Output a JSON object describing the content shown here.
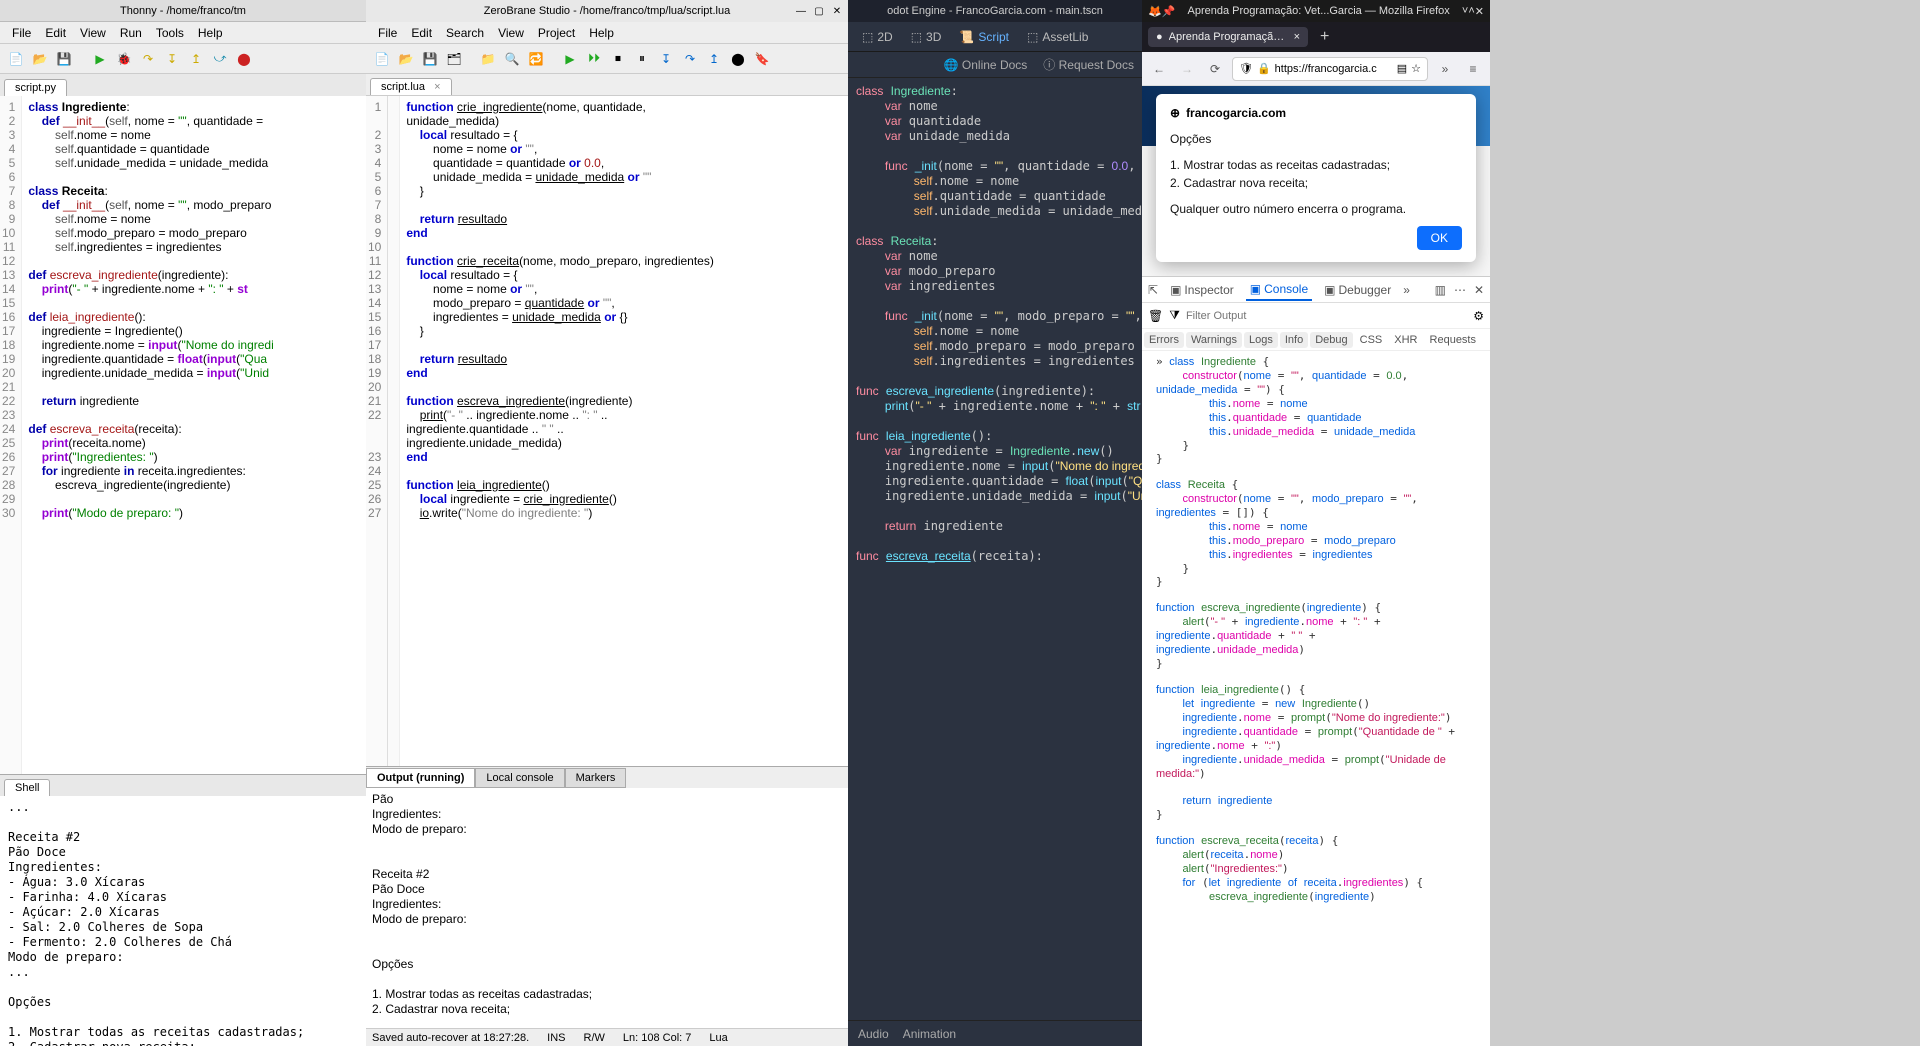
{
  "thonny": {
    "title": "Thonny  -  /home/franco/tm",
    "menu": [
      "File",
      "Edit",
      "View",
      "Run",
      "Tools",
      "Help"
    ],
    "filetab": "script.py",
    "code_lines": [
      {
        "n": 1,
        "h": "<span class='kw'>class</span> <span class='cls'>Ingrediente</span>:"
      },
      {
        "n": 2,
        "h": "    <span class='kw'>def</span> <span class='fn'>__init__</span>(<span class='self'>self</span>, nome = <span class='str'>\"\"</span>, quantidade ="
      },
      {
        "n": 3,
        "h": "        <span class='self'>self</span>.nome = nome"
      },
      {
        "n": 4,
        "h": "        <span class='self'>self</span>.quantidade = quantidade"
      },
      {
        "n": 5,
        "h": "        <span class='self'>self</span>.unidade_medida = unidade_medida"
      },
      {
        "n": 6,
        "h": ""
      },
      {
        "n": 7,
        "h": "<span class='kw'>class</span> <span class='cls'>Receita</span>:"
      },
      {
        "n": 8,
        "h": "    <span class='kw'>def</span> <span class='fn'>__init__</span>(<span class='self'>self</span>, nome = <span class='str'>\"\"</span>, modo_preparo"
      },
      {
        "n": 9,
        "h": "        <span class='self'>self</span>.nome = nome"
      },
      {
        "n": 10,
        "h": "        <span class='self'>self</span>.modo_preparo = modo_preparo"
      },
      {
        "n": 11,
        "h": "        <span class='self'>self</span>.ingredientes = ingredientes"
      },
      {
        "n": 12,
        "h": ""
      },
      {
        "n": 13,
        "h": "<span class='kw'>def</span> <span class='fn'>escreva_ingrediente</span>(ingrediente):"
      },
      {
        "n": 14,
        "h": "    <span class='kw2'>print</span>(<span class='str'>\"- \"</span> + ingrediente.nome + <span class='str'>\": \"</span> + <span class='kw2'>st</span>"
      },
      {
        "n": 15,
        "h": ""
      },
      {
        "n": 16,
        "h": "<span class='kw'>def</span> <span class='fn'>leia_ingrediente</span>():"
      },
      {
        "n": 17,
        "h": "    ingrediente = Ingrediente()"
      },
      {
        "n": 18,
        "h": "    ingrediente.nome = <span class='kw2'>input</span>(<span class='str'>\"Nome do ingredi</span>"
      },
      {
        "n": 19,
        "h": "    ingrediente.quantidade = <span class='kw2'>float</span>(<span class='kw2'>input</span>(<span class='str'>\"Qua</span>"
      },
      {
        "n": 20,
        "h": "    ingrediente.unidade_medida = <span class='kw2'>input</span>(<span class='str'>\"Unid</span>"
      },
      {
        "n": 21,
        "h": ""
      },
      {
        "n": 22,
        "h": "    <span class='kw'>return</span> ingrediente"
      },
      {
        "n": 23,
        "h": ""
      },
      {
        "n": 24,
        "h": "<span class='kw'>def</span> <span class='fn'>escreva_receita</span>(receita):"
      },
      {
        "n": 25,
        "h": "    <span class='kw2'>print</span>(receita.nome)"
      },
      {
        "n": 26,
        "h": "    <span class='kw2'>print</span>(<span class='str'>\"Ingredientes: \"</span>)"
      },
      {
        "n": 27,
        "h": "    <span class='kw'>for</span> ingrediente <span class='kw'>in</span> receita.ingredientes:"
      },
      {
        "n": 28,
        "h": "        escreva_ingrediente(ingrediente)"
      },
      {
        "n": 29,
        "h": ""
      },
      {
        "n": 30,
        "h": "    <span class='kw2'>print</span>(<span class='str'>\"Modo de preparo: \"</span>)"
      }
    ],
    "shell_tab": "Shell",
    "shell_output": "...\n\nReceita #2\nPão Doce\nIngredientes:\n- Água: 3.0 Xícaras\n- Farinha: 4.0 Xícaras\n- Açúcar: 2.0 Xícaras\n- Sal: 2.0 Colheres de Sopa\n- Fermento: 2.0 Colheres de Chá\nModo de preparo:\n...\n\nOpções\n\n1. Mostrar todas as receitas cadastradas;\n2. Cadastrar nova receita;\n\nQualquer outro número encerra o programa.\n\nEscolha uma opção:"
  },
  "zerobrane": {
    "title": "ZeroBrane Studio - /home/franco/tmp/lua/script.lua",
    "menu": [
      "File",
      "Edit",
      "Search",
      "View",
      "Project",
      "Help"
    ],
    "filetab": "script.lua",
    "code_lines": [
      {
        "n": 1,
        "h": "<span class='lkw'>function</span> <span class='lund'>crie_ingrediente</span>(nome, quantidade,"
      },
      {
        "n": "",
        "h": "unidade_medida)"
      },
      {
        "n": 2,
        "h": "    <span class='lkw'>local</span> resultado = {"
      },
      {
        "n": 3,
        "h": "        nome = nome <span class='lkw'>or</span> <span class='lstr'>\"\"</span>,"
      },
      {
        "n": 4,
        "h": "        quantidade = quantidade <span class='lkw'>or</span> <span class='lnum'>0.0</span>,"
      },
      {
        "n": 5,
        "h": "        unidade_medida = <span class='lund'>unidade_medida</span> <span class='lkw'>or</span> <span class='lstr'>\"\"</span>"
      },
      {
        "n": 6,
        "h": "    }"
      },
      {
        "n": 7,
        "h": ""
      },
      {
        "n": 8,
        "h": "    <span class='lkw'>return</span> <span class='lund'>resultado</span>"
      },
      {
        "n": 9,
        "h": "<span class='lkw'>end</span>"
      },
      {
        "n": 10,
        "h": ""
      },
      {
        "n": 11,
        "h": "<span class='lkw'>function</span> <span class='lund'>crie_receita</span>(nome, modo_preparo, ingredientes)"
      },
      {
        "n": 12,
        "h": "    <span class='lkw'>local</span> resultado = {"
      },
      {
        "n": 13,
        "h": "        nome = nome <span class='lkw'>or</span> <span class='lstr'>\"\"</span>,"
      },
      {
        "n": 14,
        "h": "        modo_preparo = <span class='lund'>quantidade</span> <span class='lkw'>or</span> <span class='lstr'>\"\"</span>,"
      },
      {
        "n": 15,
        "h": "        ingredientes = <span class='lund'>unidade_medida</span> <span class='lkw'>or</span> {}"
      },
      {
        "n": 16,
        "h": "    }"
      },
      {
        "n": 17,
        "h": ""
      },
      {
        "n": 18,
        "h": "    <span class='lkw'>return</span> <span class='lund'>resultado</span>"
      },
      {
        "n": 19,
        "h": "<span class='lkw'>end</span>"
      },
      {
        "n": 20,
        "h": ""
      },
      {
        "n": 21,
        "h": "<span class='lkw'>function</span> <span class='lund'>escreva_ingrediente</span>(ingrediente)"
      },
      {
        "n": 22,
        "h": "    <span class='lund'>print</span>(<span class='lstr'>\"- \"</span> .. ingrediente.nome .. <span class='lstr'>\": \"</span> .."
      },
      {
        "n": "",
        "h": "ingrediente.quantidade .. <span class='lstr'>\" \"</span> .."
      },
      {
        "n": "",
        "h": "ingrediente.unidade_medida)"
      },
      {
        "n": 23,
        "h": "<span class='lkw'>end</span>"
      },
      {
        "n": 24,
        "h": ""
      },
      {
        "n": 25,
        "h": "<span class='lkw'>function</span> <span class='lund'>leia_ingrediente</span>()"
      },
      {
        "n": 26,
        "h": "    <span class='lkw'>local</span> ingrediente = <span class='lund'>crie_ingrediente</span>()"
      },
      {
        "n": 27,
        "h": "    <span class='lund'>io</span>.write(<span class='lstr'>\"Nome do ingrediente: \"</span>)"
      }
    ],
    "out_tabs": [
      "Output (running)",
      "Local console",
      "Markers"
    ],
    "out_text": "Pão\nIngredientes:\nModo de preparo:\n\n\nReceita #2\nPão Doce\nIngredientes:\nModo de preparo:\n\n\nOpções\n\n1. Mostrar todas as receitas cadastradas;\n2. Cadastrar nova receita;\n\nQualquer outro número encerra o programa.\n\n»Escolha uma opção:",
    "status": {
      "save": "Saved auto-recover at 18:27:28.",
      "ins": "INS",
      "rw": "R/W",
      "pos": "Ln: 108 Col: 7",
      "lang": "Lua"
    }
  },
  "godot": {
    "title": "odot Engine - FrancoGarcia.com - main.tscn",
    "top_buttons": [
      {
        "icon": "⬚",
        "label": "2D"
      },
      {
        "icon": "⬚",
        "label": "3D"
      },
      {
        "icon": "📜",
        "label": "Script",
        "active": true
      },
      {
        "icon": "⬚",
        "label": "AssetLib"
      }
    ],
    "docs": [
      {
        "icon": "🌐",
        "label": "Online Docs"
      },
      {
        "icon": "ⓘ",
        "label": "Request Docs"
      }
    ],
    "code": "<span class='gkw'>class</span> <span class='gtype'>Ingrediente</span>:\n    <span class='gvar'>var</span> nome\n    <span class='gvar'>var</span> quantidade\n    <span class='gvar'>var</span> unidade_medida\n\n    <span class='gkw'>func</span> <span class='gfn'>_init</span>(nome = <span class='gstr'>\"\"</span>, quantidade = <span class='gnum'>0.0</span>, u\n        <span class='gself'>self</span>.nome = nome\n        <span class='gself'>self</span>.quantidade = quantidade\n        <span class='gself'>self</span>.unidade_medida = unidade_medida\n\n<span class='gkw'>class</span> <span class='gtype'>Receita</span>:\n    <span class='gvar'>var</span> nome\n    <span class='gvar'>var</span> modo_preparo\n    <span class='gvar'>var</span> ingredientes\n\n    <span class='gkw'>func</span> <span class='gfn'>_init</span>(nome = <span class='gstr'>\"\"</span>, modo_preparo = <span class='gstr'>\"\"</span>, in\n        <span class='gself'>self</span>.nome = nome\n        <span class='gself'>self</span>.modo_preparo = modo_preparo\n        <span class='gself'>self</span>.ingredientes = ingredientes\n\n<span class='gkw'>func</span> <span class='gfn'>escreva_ingrediente</span>(ingrediente):\n    <span class='gfn'>print</span>(<span class='gstr'>\"- \"</span> + ingrediente.nome + <span class='gstr'>\": \"</span> + <span class='gfn'>str</span>(\n\n<span class='gkw'>func</span> <span class='gfn'>leia_ingrediente</span>():\n    <span class='gvar'>var</span> ingrediente = <span class='gtype'>Ingrediente</span>.<span class='gfn'>new</span>()\n    ingrediente.nome = <span class='gfn'>input</span>(<span class='gstr'>\"Nome do ingredien</span>\n    ingrediente.quantidade = <span class='gfn'>float</span>(<span class='gfn'>input</span>(<span class='gstr'>\"Quan</span>\n    ingrediente.unidade_medida = <span class='gfn'>input</span>(<span class='gstr'>\"Unidade</span>\n\n    <span class='gkw'>return</span> ingrediente\n\n<span class='gkw'>func</span> <span style='text-decoration:underline' class='gfn'>escreva_receita</span>(receita):",
    "bottom_tabs": [
      "Audio",
      "Animation"
    ]
  },
  "firefox": {
    "title": "Aprenda Programação: Vet...Garcia — Mozilla Firefox",
    "tab_label": "Aprenda Programação: Vetor",
    "url": "https://francogarcia.c",
    "prompt": {
      "domain": "francogarcia.com",
      "heading": "Opções",
      "lines": [
        "1. Mostrar todas as receitas cadastradas;",
        "2. Cadastrar nova receita;"
      ],
      "footer": "Qualquer outro número encerra o programa.",
      "ok": "OK"
    },
    "devtools": {
      "tabs": [
        "Inspector",
        "Console",
        "Debugger"
      ],
      "filter_placeholder": "Filter Output",
      "cats": [
        "Errors",
        "Warnings",
        "Logs",
        "Info",
        "Debug",
        "CSS",
        "XHR",
        "Requests"
      ],
      "console": "<span class='cblue'>class</span> <span class='cgreen'>Ingrediente</span> {\n    <span class='cprop'>constructor</span>(<span class='cblue'>nome</span> = <span class='cred'>\"\"</span>, <span class='cblue'>quantidade</span> = <span class='cgreen'>0.0</span>,\n<span class='cblue'>unidade_medida</span> = <span class='cred'>\"\"</span>) {\n        <span class='cblue'>this</span>.<span class='cprop'>nome</span> = <span class='cblue'>nome</span>\n        <span class='cblue'>this</span>.<span class='cprop'>quantidade</span> = <span class='cblue'>quantidade</span>\n        <span class='cblue'>this</span>.<span class='cprop'>unidade_medida</span> = <span class='cblue'>unidade_medida</span>\n    }\n}\n\n<span class='cblue'>class</span> <span class='cgreen'>Receita</span> {\n    <span class='cprop'>constructor</span>(<span class='cblue'>nome</span> = <span class='cred'>\"\"</span>, <span class='cblue'>modo_preparo</span> = <span class='cred'>\"\"</span>,\n<span class='cblue'>ingredientes</span> = []) {\n        <span class='cblue'>this</span>.<span class='cprop'>nome</span> = <span class='cblue'>nome</span>\n        <span class='cblue'>this</span>.<span class='cprop'>modo_preparo</span> = <span class='cblue'>modo_preparo</span>\n        <span class='cblue'>this</span>.<span class='cprop'>ingredientes</span> = <span class='cblue'>ingredientes</span>\n    }\n}\n\n<span class='cblue'>function</span> <span class='cgreen'>escreva_ingrediente</span>(<span class='cblue'>ingrediente</span>) {\n    <span class='cgreen'>alert</span>(<span class='cred'>\"- \"</span> + <span class='cblue'>ingrediente</span>.<span class='cprop'>nome</span> + <span class='cred'>\": \"</span> +\n<span class='cblue'>ingrediente</span>.<span class='cprop'>quantidade</span> + <span class='cred'>\" \"</span> +\n<span class='cblue'>ingrediente</span>.<span class='cprop'>unidade_medida</span>)\n}\n\n<span class='cblue'>function</span> <span class='cgreen'>leia_ingrediente</span>() {\n    <span class='cblue'>let</span> <span class='cblue'>ingrediente</span> = <span class='cblue'>new</span> <span class='cgreen'>Ingrediente</span>()\n    <span class='cblue'>ingrediente</span>.<span class='cprop'>nome</span> = <span class='cgreen'>prompt</span>(<span class='cred'>\"Nome do ingrediente:\"</span>)\n    <span class='cblue'>ingrediente</span>.<span class='cprop'>quantidade</span> = <span class='cgreen'>prompt</span>(<span class='cred'>\"Quantidade de \"</span> +\n<span class='cblue'>ingrediente</span>.<span class='cprop'>nome</span> + <span class='cred'>\":\"</span>)\n    <span class='cblue'>ingrediente</span>.<span class='cprop'>unidade_medida</span> = <span class='cgreen'>prompt</span>(<span class='cred'>\"Unidade de\nmedida:\"</span>)\n\n    <span class='cblue'>return</span> <span class='cblue'>ingrediente</span>\n}\n\n<span class='cblue'>function</span> <span class='cgreen'>escreva_receita</span>(<span class='cblue'>receita</span>) {\n    <span class='cgreen'>alert</span>(<span class='cblue'>receita</span>.<span class='cprop'>nome</span>)\n    <span class='cgreen'>alert</span>(<span class='cred'>\"Ingredientes:\"</span>)\n    <span class='cblue'>for</span> (<span class='cblue'>let</span> <span class='cblue'>ingrediente</span> <span class='cblue'>of</span> <span class='cblue'>receita</span>.<span class='cprop'>ingredientes</span>) {\n        <span class='cgreen'>escreva_ingrediente</span>(<span class='cblue'>ingrediente</span>)"
    }
  }
}
